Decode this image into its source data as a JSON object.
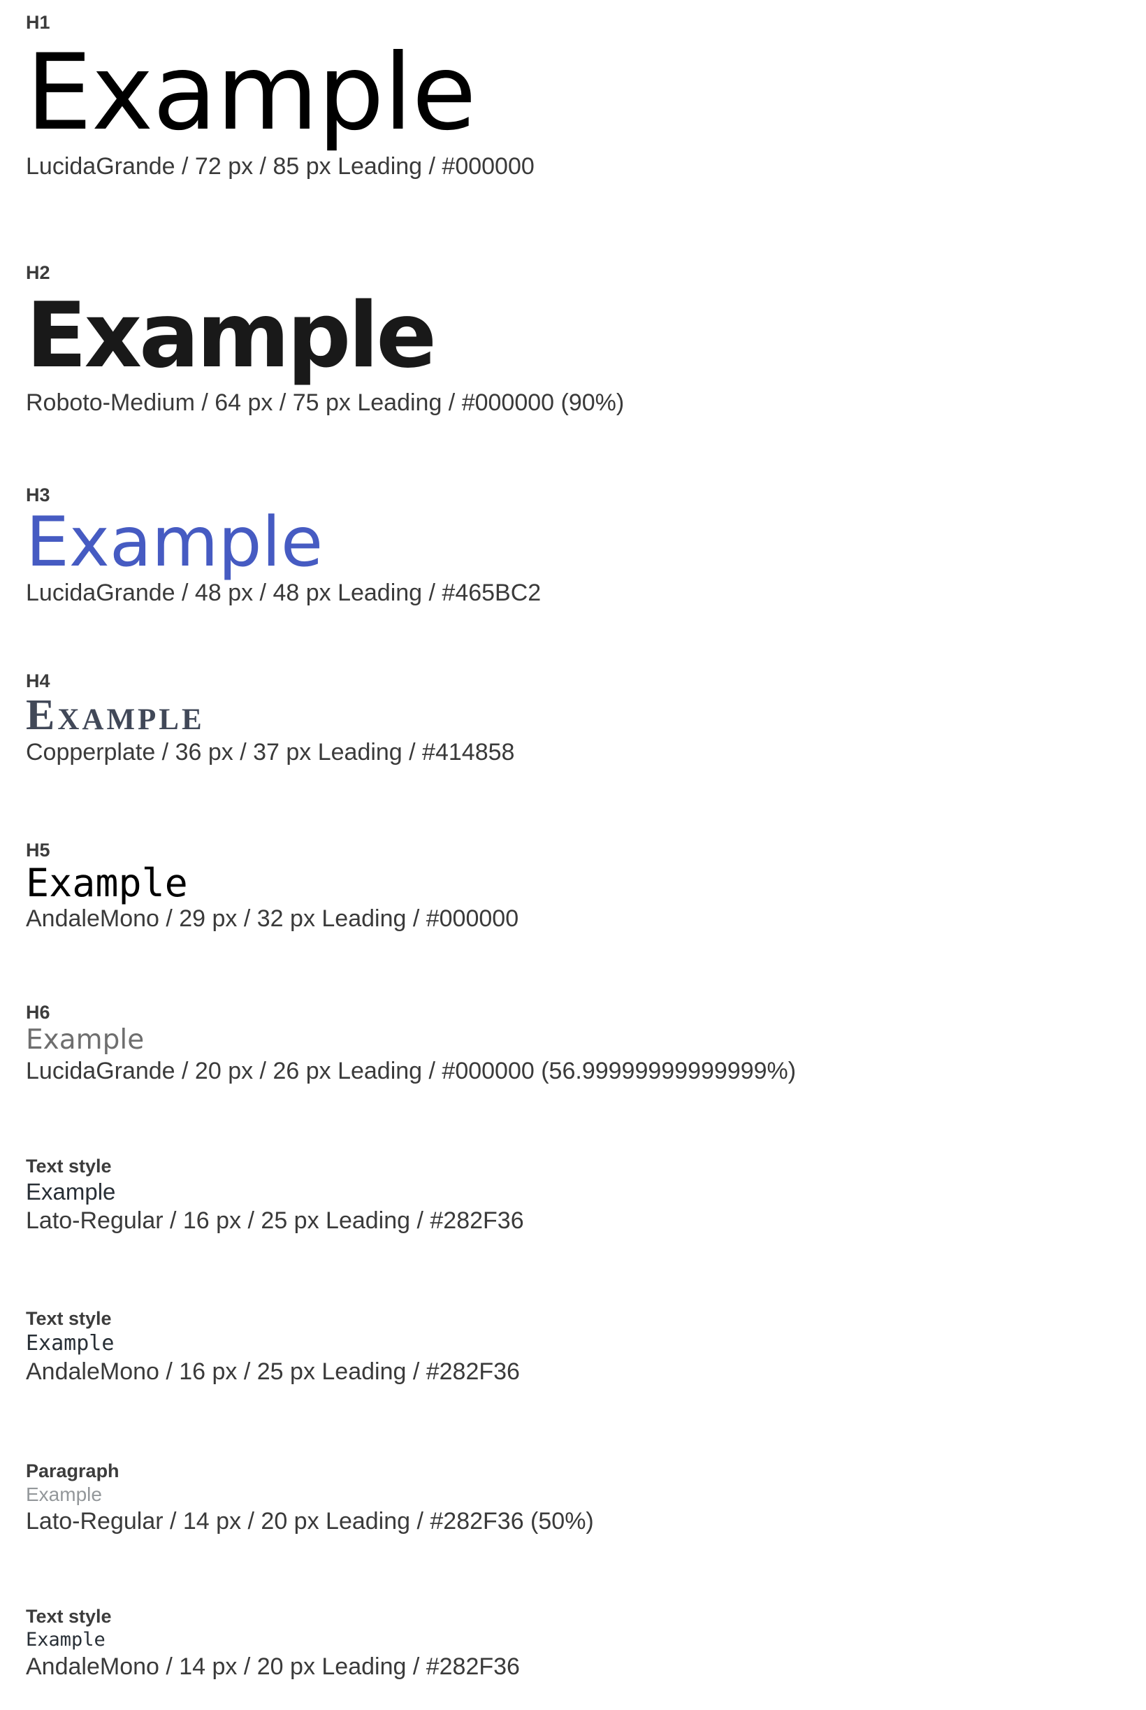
{
  "styles": [
    {
      "label": "H1",
      "sample": "Example",
      "spec": "LucidaGrande / 72 px / 85 px Leading / #000000",
      "color": "#000000"
    },
    {
      "label": "H2",
      "sample": "Example",
      "spec": "Roboto-Medium / 64 px / 75 px Leading / #000000 (90%)",
      "color": "#000000"
    },
    {
      "label": "H3",
      "sample": "Example",
      "spec": "LucidaGrande / 48 px / 48 px Leading / #465BC2",
      "color": "#465BC2"
    },
    {
      "label": "H4",
      "sample": "Example",
      "spec": "Copperplate / 36 px / 37 px Leading / #414858",
      "color": "#414858"
    },
    {
      "label": "H5",
      "sample": "Example",
      "spec": "AndaleMono / 29 px / 32 px Leading / #000000",
      "color": "#000000"
    },
    {
      "label": "H6",
      "sample": "Example",
      "spec": "LucidaGrande / 20 px / 26 px Leading / #000000 (56.99999999999999%)",
      "color": "#000000"
    },
    {
      "label": "Text style",
      "sample": "Example",
      "spec": "Lato-Regular / 16 px / 25 px Leading / #282F36",
      "color": "#282F36"
    },
    {
      "label": "Text style",
      "sample": "Example",
      "spec": "AndaleMono / 16 px / 25 px Leading / #282F36",
      "color": "#282F36"
    },
    {
      "label": "Paragraph",
      "sample": "Example",
      "spec": "Lato-Regular / 14 px / 20 px Leading / #282F36 (50%)",
      "color": "#282F36"
    },
    {
      "label": "Text style",
      "sample": "Example",
      "spec": "AndaleMono / 14 px / 20 px Leading / #282F36",
      "color": "#282F36"
    }
  ]
}
